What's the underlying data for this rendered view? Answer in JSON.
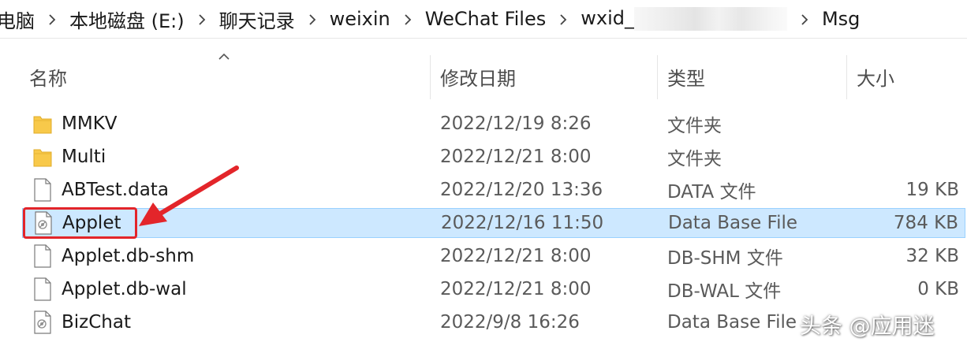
{
  "breadcrumb": {
    "items": [
      "电脑",
      "本地磁盘 (E:)",
      "聊天记录",
      "weixin",
      "WeChat Files",
      "wxid_",
      "Msg"
    ]
  },
  "columns": {
    "name": "名称",
    "date": "修改日期",
    "type": "类型",
    "size": "大小"
  },
  "files": [
    {
      "name": "MMKV",
      "date": "2022/12/19 8:26",
      "type": "文件夹",
      "size": "",
      "icon": "folder-icon"
    },
    {
      "name": "Multi",
      "date": "2022/12/21 8:00",
      "type": "文件夹",
      "size": "",
      "icon": "folder-icon"
    },
    {
      "name": "ABTest.data",
      "date": "2022/12/20 13:36",
      "type": "DATA 文件",
      "size": "19 KB",
      "icon": "file-icon"
    },
    {
      "name": "Applet",
      "date": "2022/12/16 11:50",
      "type": "Data Base File",
      "size": "784 KB",
      "icon": "database-file-icon",
      "selected": true
    },
    {
      "name": "Applet.db-shm",
      "date": "2022/12/21 8:00",
      "type": "DB-SHM 文件",
      "size": "32 KB",
      "icon": "file-icon"
    },
    {
      "name": "Applet.db-wal",
      "date": "2022/12/21 8:00",
      "type": "DB-WAL 文件",
      "size": "0 KB",
      "icon": "file-icon"
    },
    {
      "name": "BizChat",
      "date": "2022/9/8 16:26",
      "type": "Data Base File",
      "size": "",
      "icon": "database-file-icon"
    }
  ],
  "watermark": "头条 @应用迷",
  "colors": {
    "selection_bg": "#cde8ff",
    "selection_border": "#99d1ff",
    "annotation_red": "#e3252a",
    "folder_yellow": "#f8c94a"
  }
}
